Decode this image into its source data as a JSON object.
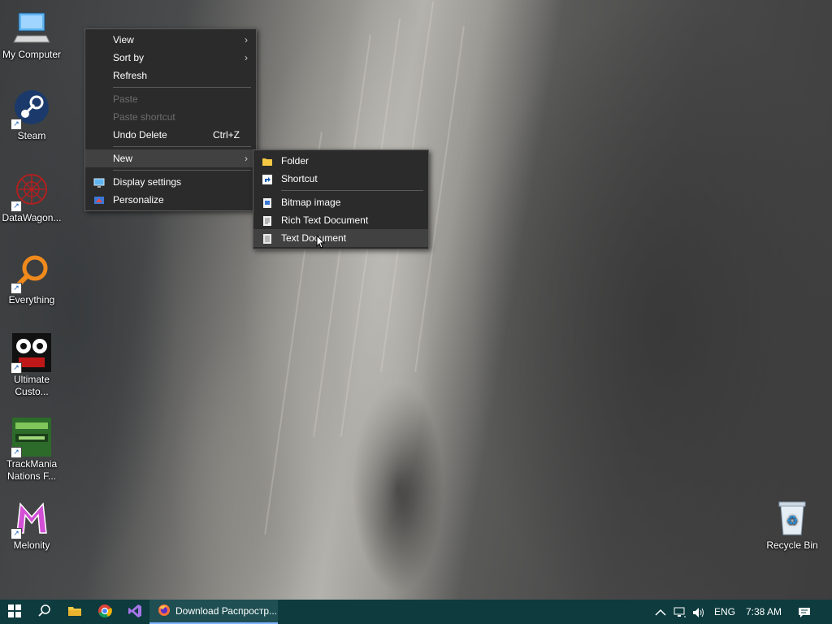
{
  "desktop": {
    "icons": [
      {
        "label": "My Computer",
        "icon": "computer-icon"
      },
      {
        "label": "Steam",
        "icon": "steam-icon"
      },
      {
        "label": "DataWagon...",
        "icon": "datawagon-icon"
      },
      {
        "label": "Everything",
        "icon": "search-icon"
      },
      {
        "label": "Ultimate Custo...",
        "icon": "ucn-icon"
      },
      {
        "label": "TrackMania Nations F...",
        "icon": "trackmania-icon"
      },
      {
        "label": "Melonity",
        "icon": "melonity-icon"
      },
      {
        "label": "Recycle Bin",
        "icon": "recycle-bin-icon"
      }
    ]
  },
  "context_menu": {
    "items": [
      {
        "label": "View",
        "submenu": true
      },
      {
        "label": "Sort by",
        "submenu": true
      },
      {
        "label": "Refresh"
      },
      {
        "label": "Paste",
        "disabled": true
      },
      {
        "label": "Paste shortcut",
        "disabled": true
      },
      {
        "label": "Undo Delete",
        "shortcut": "Ctrl+Z"
      },
      {
        "label": "New",
        "submenu": true,
        "hover": true
      },
      {
        "label": "Display settings",
        "icon": "display-icon"
      },
      {
        "label": "Personalize",
        "icon": "personalize-icon"
      }
    ]
  },
  "new_submenu": {
    "items": [
      {
        "label": "Folder",
        "icon": "folder-icon"
      },
      {
        "label": "Shortcut",
        "icon": "shortcut-icon"
      },
      {
        "label": "Bitmap image",
        "icon": "bitmap-icon"
      },
      {
        "label": "Rich Text Document",
        "icon": "rtf-icon"
      },
      {
        "label": "Text Document",
        "icon": "text-doc-icon",
        "hover": true
      }
    ]
  },
  "taskbar": {
    "active_app_title": "Download Распростр...",
    "language": "ENG",
    "time": "7:38 AM",
    "accent": "#0d3b3e"
  }
}
